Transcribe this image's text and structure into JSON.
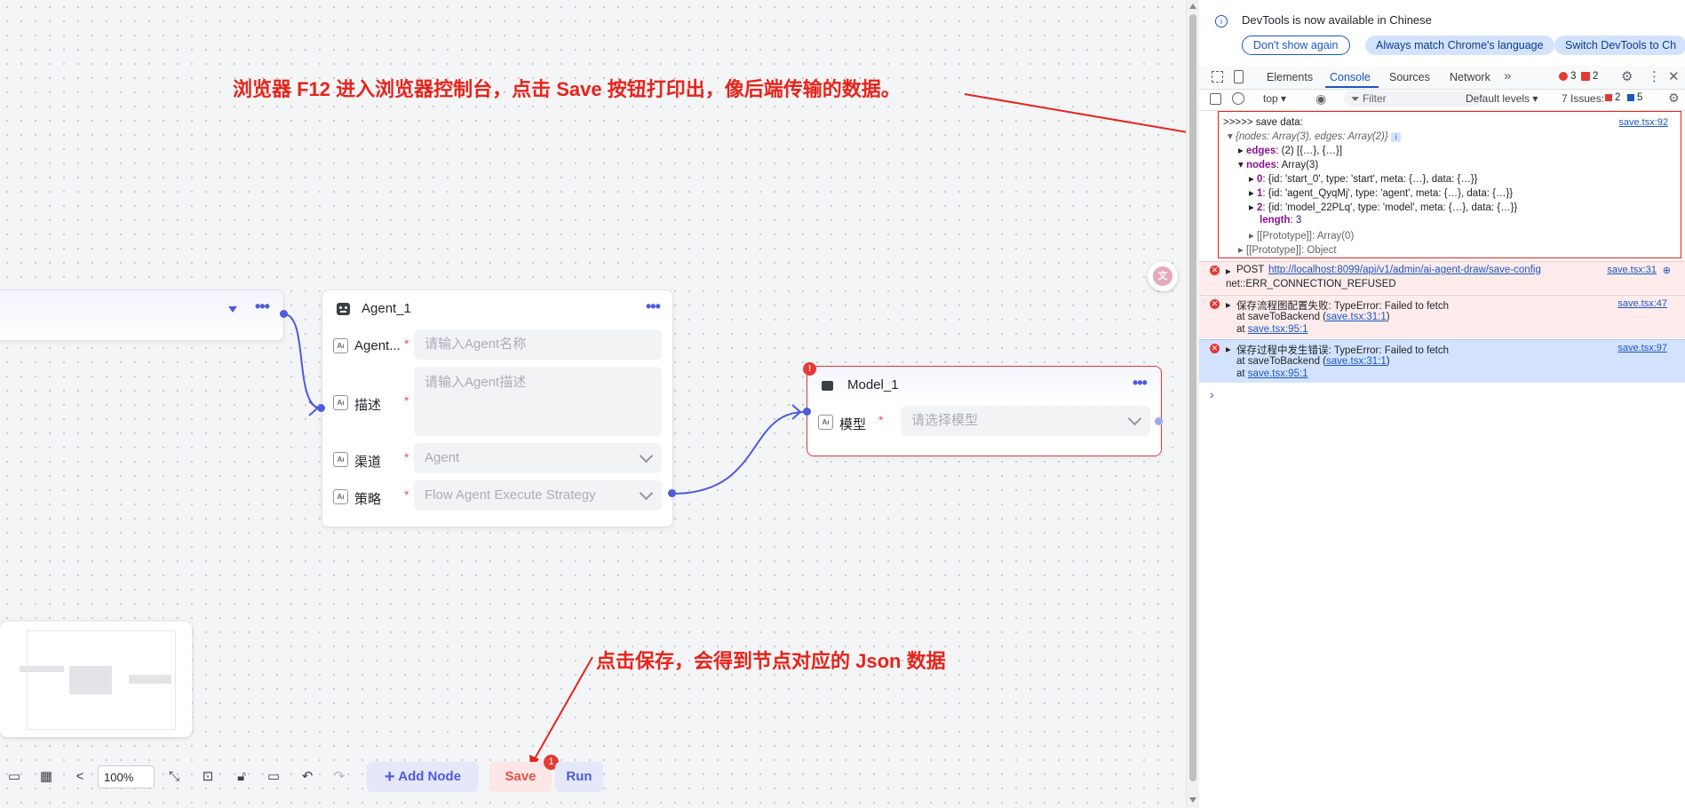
{
  "annotations": {
    "top": "浏览器 F12 进入浏览器控制台，点击 Save 按钮打印出，像后端传输的数据。",
    "bottom": "点击保存，会得到节点对应的 Json 数据"
  },
  "agent_node": {
    "title": "Agent_1",
    "fields": [
      {
        "label": "Agent...",
        "placeholder": "请输入Agent名称"
      },
      {
        "label": "描述",
        "placeholder": "请输入Agent描述"
      },
      {
        "label": "渠道",
        "value": "Agent"
      },
      {
        "label": "策略",
        "value": "Flow Agent Execute Strategy"
      }
    ]
  },
  "model_node": {
    "title": "Model_1",
    "badge": "!",
    "field_label": "模型",
    "placeholder": "请选择模型"
  },
  "toolbar": {
    "zoom": "100%",
    "add_node": "Add Node",
    "save": "Save",
    "save_badge": "1",
    "run": "Run"
  },
  "devtools": {
    "banner": "DevTools is now available in Chinese",
    "btn_dont_show": "Don't show again",
    "btn_match": "Always match Chrome's language",
    "btn_switch": "Switch DevTools to Ch",
    "tabs": [
      "Elements",
      "Console",
      "Sources",
      "Network"
    ],
    "error_count": "3",
    "warn_count": "2",
    "context": "top",
    "filter_placeholder": "Filter",
    "levels": "Default levels",
    "issues_label": "7 Issues:",
    "issues_err": "2",
    "issues_info": "5",
    "log": {
      "head": ">>>>> save data:",
      "src": "save.tsx:92",
      "summary": "{nodes: Array(3), edges: Array(2)}",
      "edges_key": "edges",
      "edges_val": "(2) [{…}, {…}]",
      "nodes_key": "nodes",
      "nodes_val": "Array(3)",
      "n0_key": "0",
      "n0": "{id: 'start_0', type: 'start', meta: {…}, data: {…}}",
      "n1_key": "1",
      "n1": "{id: 'agent_QyqMj', type: 'agent', meta: {…}, data: {…}}",
      "n2_key": "2",
      "n2": "{id: 'model_22PLq', type: 'model', meta: {…}, data: {…}}",
      "length_key": "length",
      "length_val": "3",
      "proto_arr": "[[Prototype]]: Array(0)",
      "proto_obj": "[[Prototype]]: Object"
    },
    "err1": {
      "prefix": "POST",
      "url": "http://localhost:8099/api/v1/admin/ai-agent-draw/save-config",
      "src": "save.tsx:31",
      "line2": "net::ERR_CONNECTION_REFUSED"
    },
    "err2": {
      "msg": "保存流程图配置失败: TypeError: Failed to fetch",
      "src": "save.tsx:47",
      "at1_pre": "at saveToBackend (",
      "at1_link": "save.tsx:31:1",
      "at1_post": ")",
      "at2_pre": "at ",
      "at2_link": "save.tsx:95:1"
    },
    "err3": {
      "msg": "保存过程中发生错误: TypeError: Failed to fetch",
      "src": "save.tsx:97",
      "at1_pre": "at saveToBackend (",
      "at1_link": "save.tsx:31:1",
      "at1_post": ")",
      "at2_pre": "at ",
      "at2_link": "save.tsx:95:1"
    },
    "prompt": "›"
  },
  "colors": {
    "accent": "#4e5bdc",
    "annotation": "#e8231a",
    "error_bg": "#fdeceb",
    "selected_bg": "#d3e3fd"
  }
}
